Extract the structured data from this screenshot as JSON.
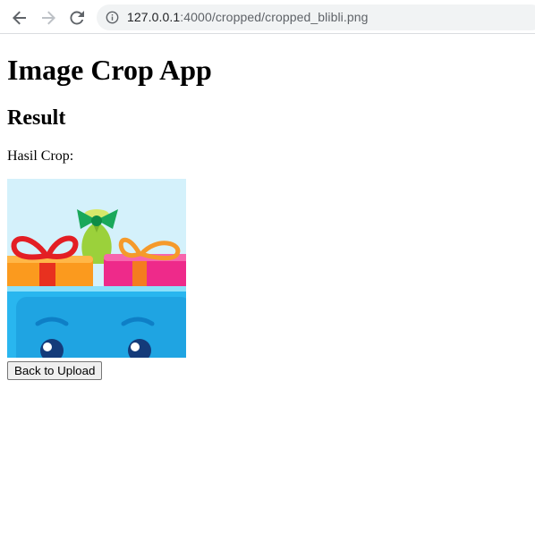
{
  "browser": {
    "url_host": "127.0.0.1",
    "url_path": ":4000/cropped/cropped_blibli.png",
    "icons": {
      "back": "arrow-left-icon",
      "forward": "arrow-right-icon",
      "reload": "reload-icon",
      "info": "info-icon"
    }
  },
  "page": {
    "title": "Image Crop App",
    "subtitle": "Result",
    "result_label": "Hasil Crop:",
    "back_button_label": "Back to Upload"
  },
  "image": {
    "sky_color": "#d4f1fb",
    "box_color": "#29b6ef"
  }
}
